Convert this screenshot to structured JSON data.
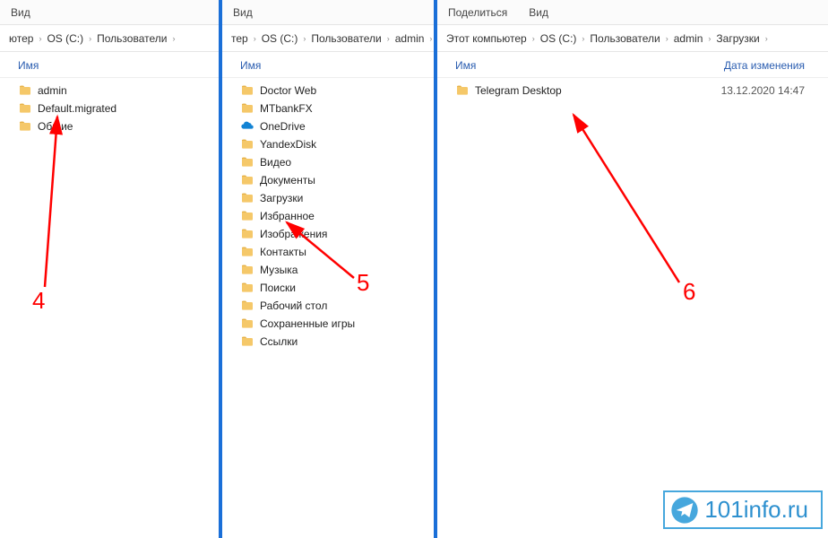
{
  "panel1": {
    "toolbar": {
      "view": "Вид"
    },
    "breadcrumb": [
      "ютер",
      "OS (C:)",
      "Пользователи"
    ],
    "header": {
      "name": "Имя"
    },
    "items": [
      {
        "icon": "folder",
        "label": "admin"
      },
      {
        "icon": "folder",
        "label": "Default.migrated"
      },
      {
        "icon": "folder",
        "label": "Общие"
      }
    ]
  },
  "panel2": {
    "toolbar": {
      "view": "Вид"
    },
    "breadcrumb": [
      "тер",
      "OS (C:)",
      "Пользователи",
      "admin"
    ],
    "header": {
      "name": "Имя"
    },
    "items": [
      {
        "icon": "folder",
        "label": "Doctor Web"
      },
      {
        "icon": "folder",
        "label": "MTbankFX"
      },
      {
        "icon": "onedrive",
        "label": "OneDrive"
      },
      {
        "icon": "folder",
        "label": "YandexDisk"
      },
      {
        "icon": "folder",
        "label": "Видео"
      },
      {
        "icon": "folder",
        "label": "Документы"
      },
      {
        "icon": "folder",
        "label": "Загрузки"
      },
      {
        "icon": "folder",
        "label": "Избранное"
      },
      {
        "icon": "folder",
        "label": "Изображения"
      },
      {
        "icon": "folder",
        "label": "Контакты"
      },
      {
        "icon": "folder",
        "label": "Музыка"
      },
      {
        "icon": "folder",
        "label": "Поиски"
      },
      {
        "icon": "folder",
        "label": "Рабочий стол"
      },
      {
        "icon": "folder",
        "label": "Сохраненные игры"
      },
      {
        "icon": "folder",
        "label": "Ссылки"
      }
    ]
  },
  "panel3": {
    "toolbar": {
      "share": "Поделиться",
      "view": "Вид"
    },
    "breadcrumb": [
      "Этот компьютер",
      "OS (C:)",
      "Пользователи",
      "admin",
      "Загрузки"
    ],
    "header": {
      "name": "Имя",
      "date": "Дата изменения"
    },
    "items": [
      {
        "icon": "folder",
        "label": "Telegram Desktop",
        "date": "13.12.2020 14:47"
      }
    ]
  },
  "annotations": {
    "n4": "4",
    "n5": "5",
    "n6": "6"
  },
  "watermark": "101info.ru"
}
